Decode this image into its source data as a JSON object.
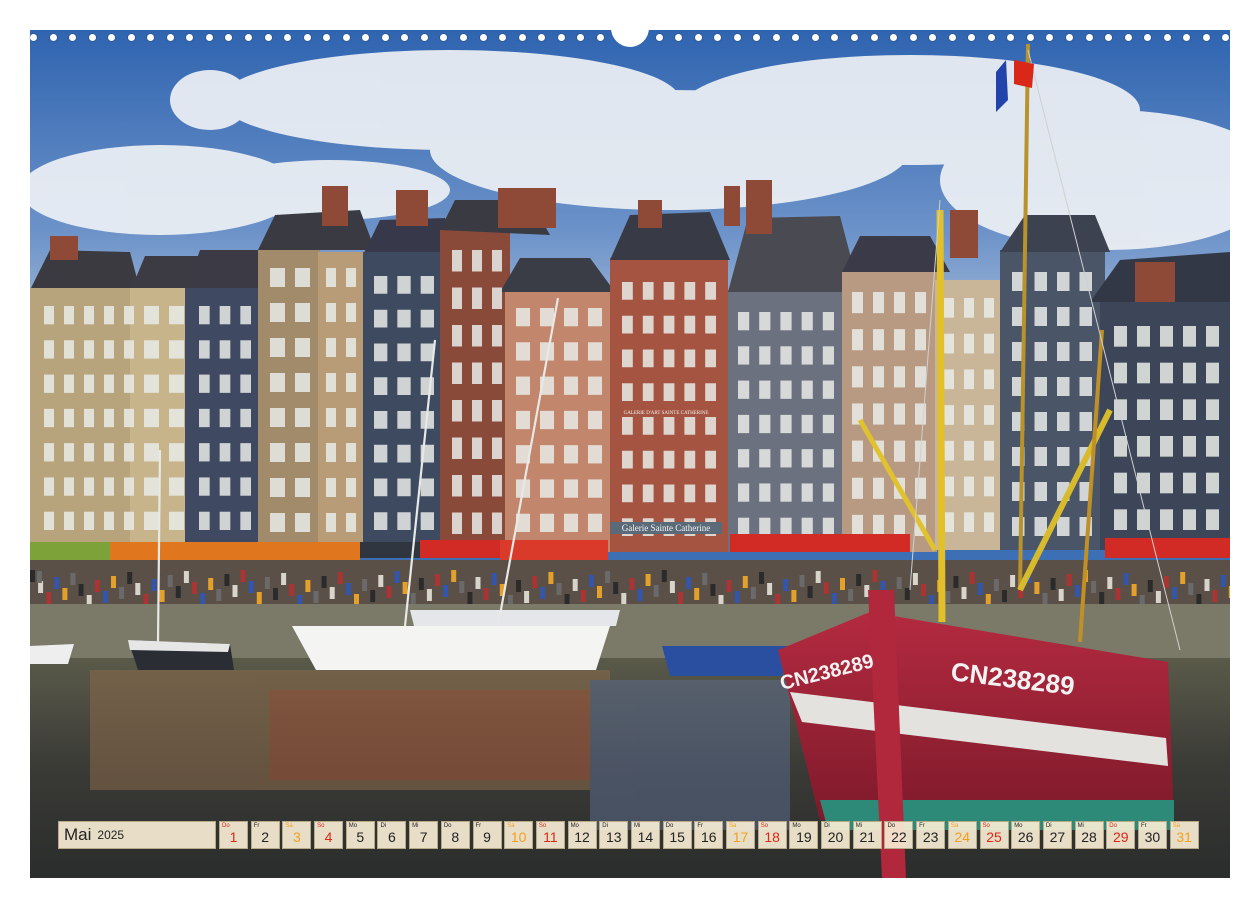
{
  "calendar": {
    "month": "Mai",
    "year": "2025",
    "days": [
      {
        "n": "1",
        "dow": "Do",
        "kind": "holiday"
      },
      {
        "n": "2",
        "dow": "Fr",
        "kind": "weekday"
      },
      {
        "n": "3",
        "dow": "Sa",
        "kind": "sat"
      },
      {
        "n": "4",
        "dow": "So",
        "kind": "sun"
      },
      {
        "n": "5",
        "dow": "Mo",
        "kind": "weekday"
      },
      {
        "n": "6",
        "dow": "Di",
        "kind": "weekday"
      },
      {
        "n": "7",
        "dow": "Mi",
        "kind": "weekday"
      },
      {
        "n": "8",
        "dow": "Do",
        "kind": "weekday"
      },
      {
        "n": "9",
        "dow": "Fr",
        "kind": "weekday"
      },
      {
        "n": "10",
        "dow": "Sa",
        "kind": "sat"
      },
      {
        "n": "11",
        "dow": "So",
        "kind": "sun"
      },
      {
        "n": "12",
        "dow": "Mo",
        "kind": "weekday"
      },
      {
        "n": "13",
        "dow": "Di",
        "kind": "weekday"
      },
      {
        "n": "14",
        "dow": "Mi",
        "kind": "weekday"
      },
      {
        "n": "15",
        "dow": "Do",
        "kind": "weekday"
      },
      {
        "n": "16",
        "dow": "Fr",
        "kind": "weekday"
      },
      {
        "n": "17",
        "dow": "Sa",
        "kind": "sat"
      },
      {
        "n": "18",
        "dow": "So",
        "kind": "sun"
      },
      {
        "n": "19",
        "dow": "Mo",
        "kind": "weekday"
      },
      {
        "n": "20",
        "dow": "Di",
        "kind": "weekday"
      },
      {
        "n": "21",
        "dow": "Mi",
        "kind": "weekday"
      },
      {
        "n": "22",
        "dow": "Do",
        "kind": "weekday"
      },
      {
        "n": "23",
        "dow": "Fr",
        "kind": "weekday"
      },
      {
        "n": "24",
        "dow": "Sa",
        "kind": "sat"
      },
      {
        "n": "25",
        "dow": "So",
        "kind": "sun"
      },
      {
        "n": "26",
        "dow": "Mo",
        "kind": "weekday"
      },
      {
        "n": "27",
        "dow": "Di",
        "kind": "weekday"
      },
      {
        "n": "28",
        "dow": "Mi",
        "kind": "weekday"
      },
      {
        "n": "29",
        "dow": "Do",
        "kind": "holiday"
      },
      {
        "n": "30",
        "dow": "Fr",
        "kind": "weekday"
      },
      {
        "n": "31",
        "dow": "Sa",
        "kind": "sat"
      }
    ]
  },
  "photo": {
    "boat_registration": "CN238289",
    "boat_registration_side": "CN238289",
    "shop_sign": "Galerie Sainte Catherine",
    "shop_sign_upper": "GALERIE D'ART SAINTE CATHERINE"
  },
  "colors": {
    "sky": "#3e72b8",
    "water": "#3b3d3a",
    "hull_red": "#a8243a",
    "awning_red": "#d22a24",
    "calendar_cell": "#f6ecd4",
    "weekend_sat": "#f0a01e",
    "weekend_sun": "#d92818"
  }
}
